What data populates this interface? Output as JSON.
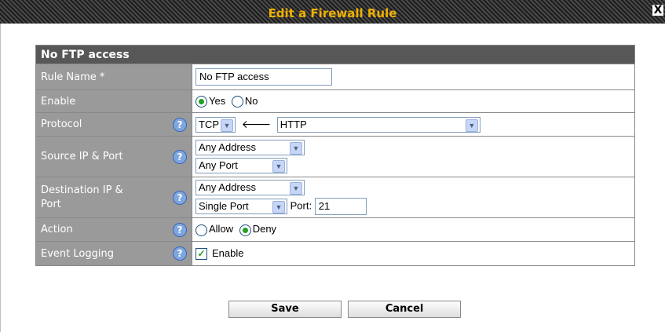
{
  "window": {
    "title": "Edit a Firewall Rule",
    "close_glyph": "X"
  },
  "form": {
    "header": "No FTP access",
    "rule_name": {
      "label": "Rule Name *",
      "value": "No FTP access"
    },
    "enable": {
      "label": "Enable",
      "options": [
        "Yes",
        "No"
      ],
      "selected": "Yes"
    },
    "protocol": {
      "label": "Protocol",
      "protocol_value": "TCP",
      "service_value": "HTTP"
    },
    "source": {
      "label": "Source IP & Port",
      "address_value": "Any Address",
      "port_value": "Any Port"
    },
    "destination": {
      "label": "Destination IP & Port",
      "address_value": "Any Address",
      "port_mode_value": "Single Port",
      "port_label": "Port:",
      "port_value": "21"
    },
    "action": {
      "label": "Action",
      "options": [
        "Allow",
        "Deny"
      ],
      "selected": "Deny"
    },
    "logging": {
      "label": "Event Logging",
      "checkbox_label": "Enable",
      "checked": true
    }
  },
  "buttons": {
    "save": "Save",
    "cancel": "Cancel"
  },
  "colors": {
    "title_text": "#f0b000",
    "header_bg": "#575757",
    "label_bg": "#9a9a9a",
    "help_icon": "#7fa6de"
  }
}
